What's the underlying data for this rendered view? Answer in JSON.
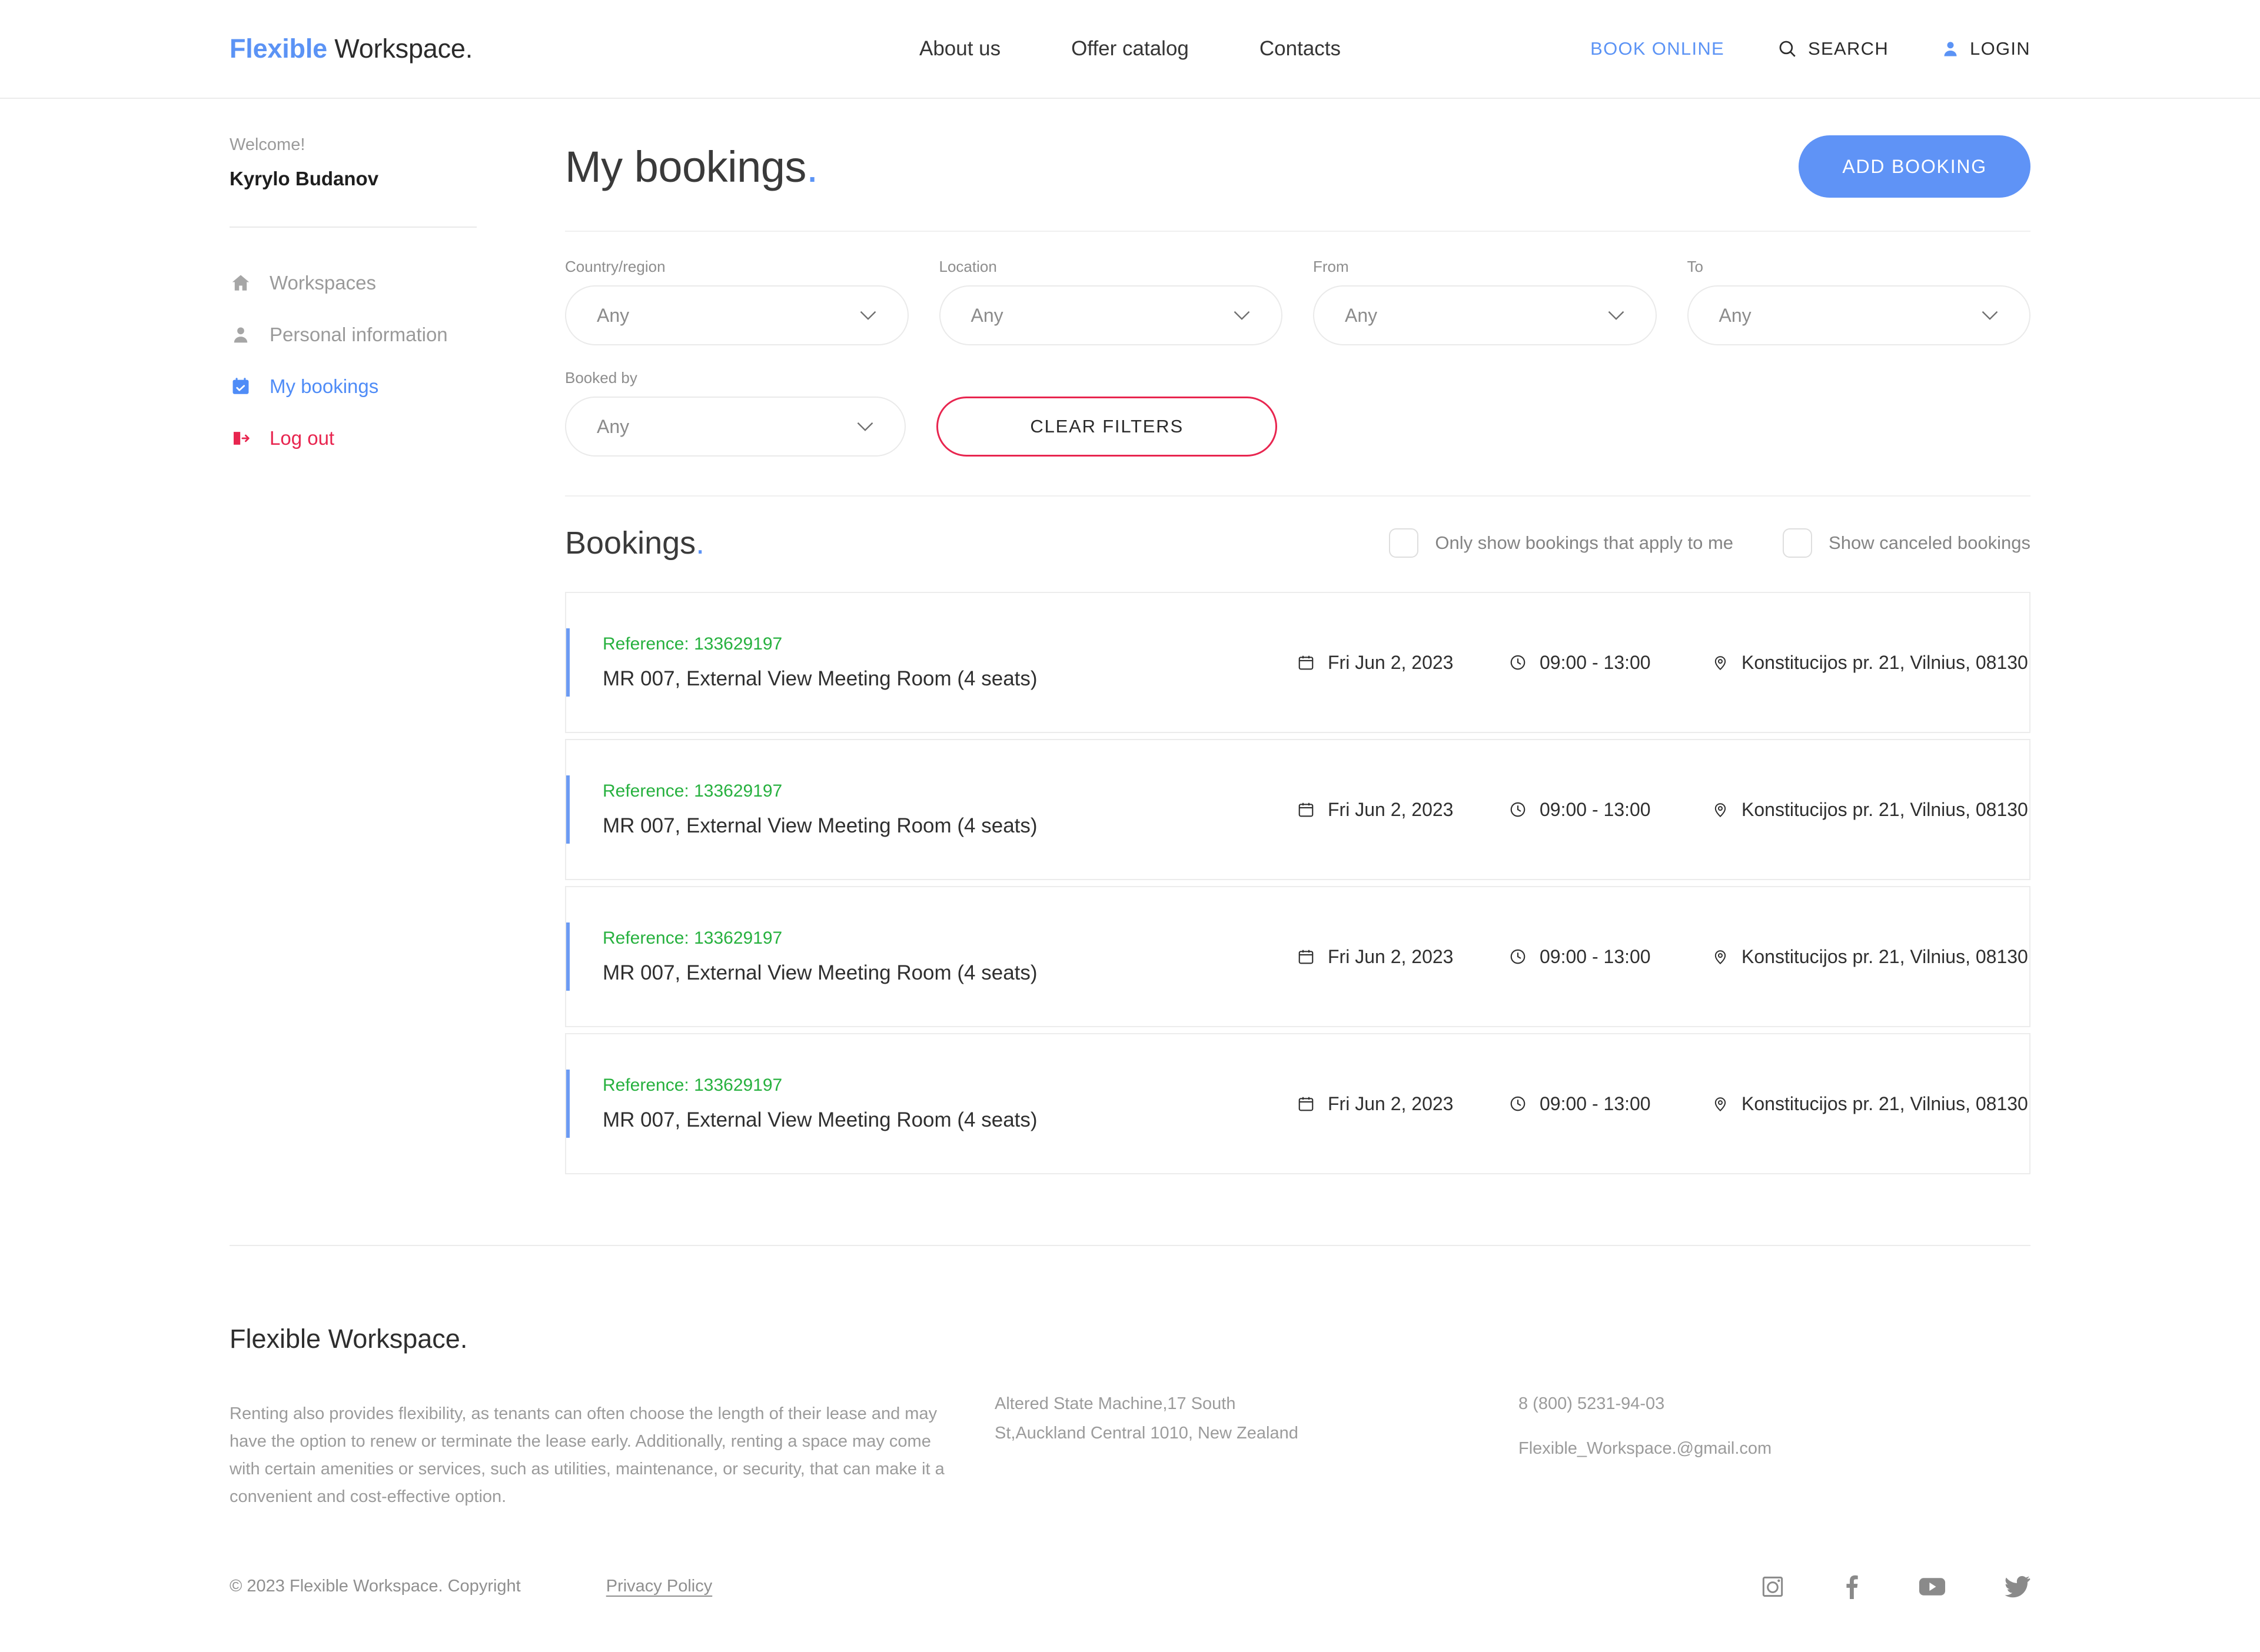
{
  "brand": {
    "first": "Flexible",
    "second": " Workspace",
    "dot": "."
  },
  "header": {
    "nav": [
      {
        "label": "About us"
      },
      {
        "label": "Offer catalog"
      },
      {
        "label": "Contacts"
      }
    ],
    "book_online": "BOOK ONLINE",
    "search": "SEARCH",
    "login": "LOGIN"
  },
  "sidebar": {
    "welcome": "Welcome!",
    "user": "Kyrylo Budanov",
    "items": [
      {
        "label": "Workspaces",
        "icon": "home-icon"
      },
      {
        "label": "Personal information",
        "icon": "user-icon"
      },
      {
        "label": "My bookings",
        "icon": "calendar-check-icon"
      },
      {
        "label": "Log out",
        "icon": "logout-icon"
      }
    ]
  },
  "main": {
    "title": "My bookings",
    "title_dot": ".",
    "add_booking": "ADD BOOKING",
    "filters": {
      "country": {
        "label": "Country/region",
        "value": "Any"
      },
      "location": {
        "label": "Location",
        "value": "Any"
      },
      "from": {
        "label": "From",
        "value": "Any"
      },
      "to": {
        "label": "To",
        "value": "Any"
      },
      "booked_by": {
        "label": "Booked by",
        "value": "Any"
      },
      "clear": "CLEAR FILTERS"
    },
    "bookings": {
      "title": "Bookings",
      "title_dot": ".",
      "checkbox_only_mine": "Only show bookings that apply to me",
      "checkbox_canceled": "Show canceled bookings",
      "rows": [
        {
          "reference": "Reference: 133629197",
          "room": "MR 007, External View Meeting Room (4 seats)",
          "date": "Fri Jun 2, 2023",
          "time": "09:00 - 13:00",
          "address": "Konstitucijos pr. 21, Vilnius, 08130"
        },
        {
          "reference": "Reference: 133629197",
          "room": "MR 007, External View Meeting Room (4 seats)",
          "date": "Fri Jun 2, 2023",
          "time": "09:00 - 13:00",
          "address": "Konstitucijos pr. 21, Vilnius, 08130"
        },
        {
          "reference": "Reference: 133629197",
          "room": "MR 007, External View Meeting Room (4 seats)",
          "date": "Fri Jun 2, 2023",
          "time": "09:00 - 13:00",
          "address": "Konstitucijos pr. 21, Vilnius, 08130"
        },
        {
          "reference": "Reference: 133629197",
          "room": "MR 007, External View Meeting Room (4 seats)",
          "date": "Fri Jun 2, 2023",
          "time": "09:00 - 13:00",
          "address": "Konstitucijos pr. 21, Vilnius, 08130"
        }
      ]
    }
  },
  "footer": {
    "description": "Renting also provides flexibility, as tenants can often choose the length of their lease and may have the option to renew or terminate the lease early. Additionally, renting a space may come with certain amenities or services, such as utilities, maintenance, or security, that can make it a convenient and cost-effective option.",
    "address_line1": "Altered State Machine,17 South",
    "address_line2": "St,Auckland Central 1010, New Zealand",
    "phone": "8 (800) 5231-94-03",
    "email": "Flexible_Workspace.@gmail.com",
    "copyright": "© 2023 Flexible Workspace. Copyright",
    "privacy": "Privacy Policy",
    "socials": [
      "instagram-icon",
      "facebook-icon",
      "youtube-icon",
      "twitter-icon"
    ]
  },
  "colors": {
    "accent_blue": "#5b93f5",
    "danger_red": "#e8254f",
    "reference_green": "#27b13f",
    "muted_gray": "#9a9a9a"
  }
}
